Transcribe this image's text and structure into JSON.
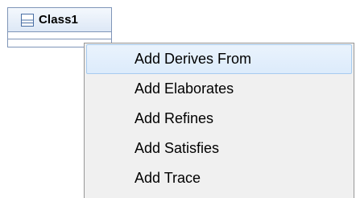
{
  "diagram": {
    "class_node": {
      "name": "Class1",
      "icon": "class-icon"
    }
  },
  "context_menu": {
    "items": [
      {
        "label": "Add Derives From",
        "highlighted": true
      },
      {
        "label": "Add Elaborates",
        "highlighted": false
      },
      {
        "label": "Add Refines",
        "highlighted": false
      },
      {
        "label": "Add Satisfies",
        "highlighted": false
      },
      {
        "label": "Add Trace",
        "highlighted": false
      }
    ]
  },
  "colors": {
    "node_border": "#7f95b8",
    "menu_background": "#f0f0f0",
    "menu_highlight": "#dcebfb",
    "menu_highlight_border": "#a6cbef"
  }
}
